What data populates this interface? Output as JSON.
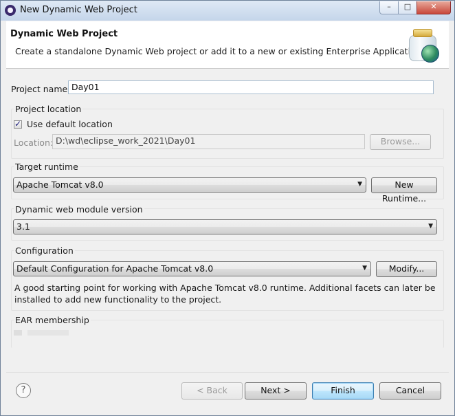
{
  "window": {
    "title": "New Dynamic Web Project",
    "minimize": "–",
    "maximize": "□",
    "close": "✕"
  },
  "header": {
    "title": "Dynamic Web Project",
    "description": "Create a standalone Dynamic Web project or add it to a new or existing Enterprise Application."
  },
  "project_name": {
    "label": "Project name:",
    "value": "Day01"
  },
  "project_location": {
    "group_label": "Project location",
    "use_default_label": "Use default location",
    "use_default_checked": true,
    "location_label": "Location:",
    "location_value": "D:\\wd\\eclipse_work_2021\\Day01",
    "browse_label": "Browse..."
  },
  "target_runtime": {
    "group_label": "Target runtime",
    "selected": "Apache Tomcat v8.0",
    "new_runtime_label": "New Runtime..."
  },
  "module_version": {
    "group_label": "Dynamic web module version",
    "selected": "3.1"
  },
  "configuration": {
    "group_label": "Configuration",
    "selected": "Default Configuration for Apache Tomcat v8.0",
    "modify_label": "Modify...",
    "description_line1": "A good starting point for working with Apache Tomcat v8.0 runtime. Additional facets can later be",
    "description_line2": "installed to add new functionality to the project."
  },
  "ear": {
    "group_label": "EAR membership"
  },
  "footer": {
    "help": "?",
    "back_label": "< Back",
    "next_label": "Next >",
    "finish_label": "Finish",
    "cancel_label": "Cancel"
  }
}
